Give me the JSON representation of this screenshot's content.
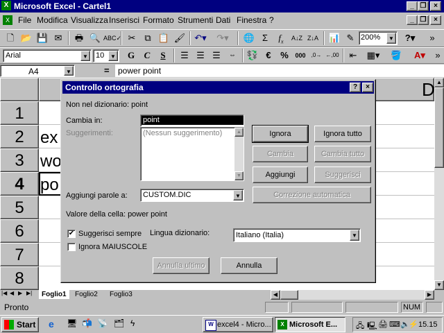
{
  "app": {
    "title": "Microsoft Excel - Cartel1"
  },
  "menu": {
    "items": [
      "File",
      "Modifica",
      "Visualizza",
      "Inserisci",
      "Formato",
      "Strumenti",
      "Dati",
      "Finestra",
      "?"
    ]
  },
  "toolbar": {
    "zoom": "200%"
  },
  "format_toolbar": {
    "font": "Arial",
    "size": "10"
  },
  "formula_bar": {
    "name_box": "A4",
    "equals": "=",
    "value": "power point"
  },
  "sheet": {
    "column_d": "D",
    "rows": [
      "1",
      "2",
      "3",
      "4",
      "5",
      "6",
      "7",
      "8"
    ],
    "cells": [
      "ex",
      "wo",
      "po"
    ]
  },
  "tabs": [
    "Foglio1",
    "Foglio2",
    "Foglio3"
  ],
  "status": {
    "left": "Pronto",
    "num": "NUM"
  },
  "dialog": {
    "title": "Controllo ortografia",
    "not_in_dict": "Non nel dizionario: point",
    "change_to_label": "Cambia in:",
    "change_to_value": "point",
    "suggestions_label": "Suggerimenti:",
    "suggestion_empty": "(Nessun suggerimento)",
    "add_words_label": "Aggiungi parole a:",
    "add_words_value": "CUSTOM.DIC",
    "cell_value": "Valore della cella: power point",
    "always_suggest": "Suggerisci sempre",
    "ignore_upper": "Ignora MAIUSCOLE",
    "dict_lang_label": "Lingua dizionario:",
    "dict_lang_value": "Italiano (Italia)",
    "btn_ignore": "Ignora",
    "btn_ignore_all": "Ignora tutto",
    "btn_change": "Cambia",
    "btn_change_all": "Cambia tutto",
    "btn_add": "Aggiungi",
    "btn_suggest": "Suggerisci",
    "btn_autocorrect": "Correzione automatica",
    "btn_undo_last": "Annulla ultimo",
    "btn_cancel": "Annulla",
    "help": "?",
    "close": "×"
  },
  "taskbar": {
    "start": "Start",
    "task1": "excel4 - Micro...",
    "task2": "Microsoft E...",
    "clock": "15.15"
  },
  "colors": {
    "title_active": "#000080",
    "face": "#c0c0c0"
  }
}
